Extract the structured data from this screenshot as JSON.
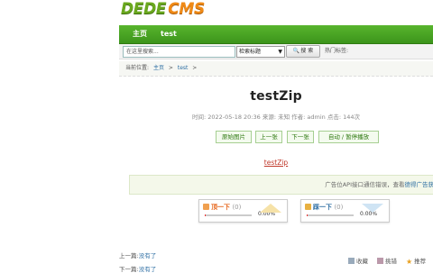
{
  "logo": {
    "part1": "DEDE",
    "part2": "CMS"
  },
  "nav": {
    "items": [
      "主页",
      "test"
    ]
  },
  "search": {
    "placeholder": "在这里搜索...",
    "select_value": "检索标题",
    "button": "搜 索",
    "hot_label": "热门标签:"
  },
  "breadcrumb": {
    "prefix": "当前位置:",
    "home": "主页",
    "sep": ">",
    "section": "test",
    "sep2": ">"
  },
  "article": {
    "title": "testZip",
    "meta": "时间: 2022-05-18 20:36 来源: 未知 作者: admin 点击: 144次",
    "buttons": [
      "原始图片",
      "上一张",
      "下一张",
      "自动 / 暂停播放"
    ],
    "link_text": "testZip"
  },
  "ad": {
    "text": "广告位API接口通信错误，查看",
    "link": "德得广告获"
  },
  "votes": [
    {
      "label": "顶一下",
      "count": "(0)",
      "percent_text": "0.00%",
      "percent": 0,
      "color": "#e6651a"
    },
    {
      "label": "踩一下",
      "count": "(0)",
      "percent_text": "0.00%",
      "percent": 0,
      "color": "#2d6ea3"
    }
  ],
  "prev_next": {
    "prev_label": "上一篇:",
    "prev_value": "没有了",
    "next_label": "下一篇:",
    "next_value": "没有了"
  },
  "tools": [
    "收藏",
    "挑错",
    "推荐"
  ],
  "colors": {
    "brand_green": "#3c941b",
    "logo_orange": "#f08a16",
    "link_blue": "#2d6ea3"
  }
}
